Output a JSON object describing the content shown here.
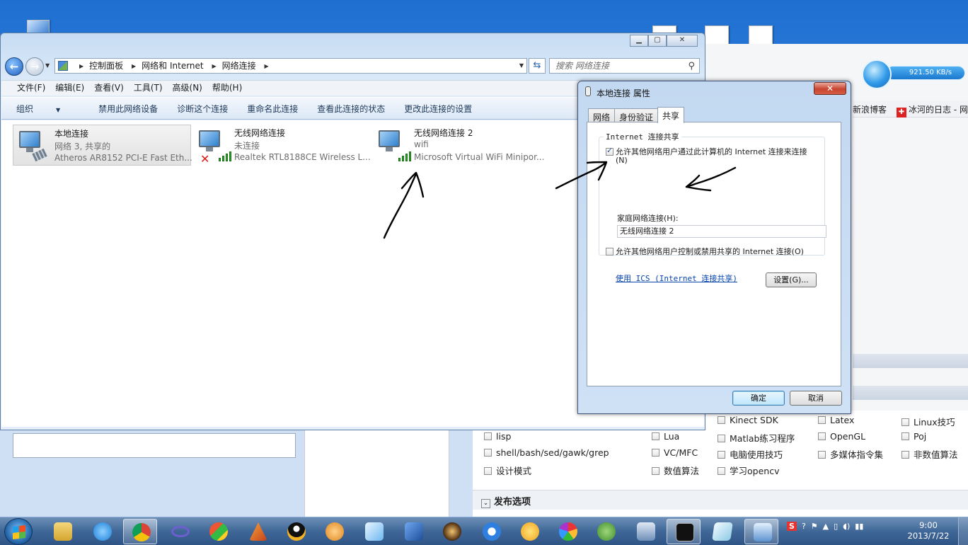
{
  "explorer": {
    "breadcrumb": [
      "控制面板",
      "网络和 Internet",
      "网络连接"
    ],
    "search_placeholder": "搜索 网络连接",
    "menu": [
      "文件(F)",
      "编辑(E)",
      "查看(V)",
      "工具(T)",
      "高级(N)",
      "帮助(H)"
    ],
    "commands": [
      "组织",
      "禁用此网络设备",
      "诊断这个连接",
      "重命名此连接",
      "查看此连接的状态",
      "更改此连接的设置"
    ],
    "connections": [
      {
        "name": "本地连接",
        "status": "网络  3, 共享的",
        "device": "Atheros AR8152 PCI-E Fast Eth...",
        "icon": "wired-network-icon"
      },
      {
        "name": "无线网络连接",
        "status": "未连接",
        "device": "Realtek RTL8188CE Wireless L...",
        "icon": "wireless-disconnected-icon"
      },
      {
        "name": "无线网络连接 2",
        "status": "wifi",
        "device": "Microsoft Virtual WiFi Minipor...",
        "icon": "wireless-network-icon"
      }
    ]
  },
  "dialog": {
    "title": "本地连接 属性",
    "close_label": "✕",
    "tabs": [
      "网络",
      "身份验证",
      "共享"
    ],
    "active_tab": "共享",
    "group_title": "Internet 连接共享",
    "allow_share_label": "允许其他网络用户通过此计算机的 Internet 连接来连接(N)",
    "allow_share_checked": true,
    "home_network_label": "家庭网络连接(H):",
    "home_network_value": "无线网络连接 2",
    "allow_control_label": "允许其他网络用户控制或禁用共享的 Internet 连接(O)",
    "allow_control_checked": false,
    "ics_link": "使用 ICS (Internet 连接共享)",
    "settings_button": "设置(G)...",
    "ok_button": "确定",
    "cancel_button": "取消"
  },
  "background": {
    "speed": "921.50 KB/s",
    "bookmarks": [
      "新浪博客",
      "冰河的日志 - 网"
    ],
    "categories": [
      [
        "Kinect SDK",
        "Latex",
        "Linux技巧"
      ],
      [
        "lisp",
        "Lua",
        "Matlab练习程序",
        "OpenGL",
        "Poj"
      ],
      [
        "shell/bash/sed/gawk/grep",
        "VC/MFC",
        "电脑使用技巧",
        "多媒体指令集",
        "非数值算法"
      ],
      [
        "设计模式",
        "数值算法",
        "学习opencv"
      ]
    ],
    "publish_section": "发布选项"
  },
  "taskbar": {
    "apps": [
      "explorer-icon",
      "ie-icon",
      "chrome-icon",
      "infinity-icon",
      "app-icon",
      "matlab-icon",
      "qq-icon",
      "media-icon",
      "photo-icon",
      "network-tool-icon",
      "game-icon",
      "thunder-icon",
      "pet-icon",
      "picasa-icon",
      "evernote-icon",
      "terminal-server-icon",
      "cmd-icon",
      "notepad-icon",
      "network-center-icon"
    ],
    "time": "9:00",
    "date": "2013/7/22"
  },
  "colors": {
    "desktop": "#2a74d2",
    "link": "#0645ad",
    "close_button": "#c8442f",
    "signal_green": "#2eaa28",
    "error_red": "#d91a12"
  }
}
